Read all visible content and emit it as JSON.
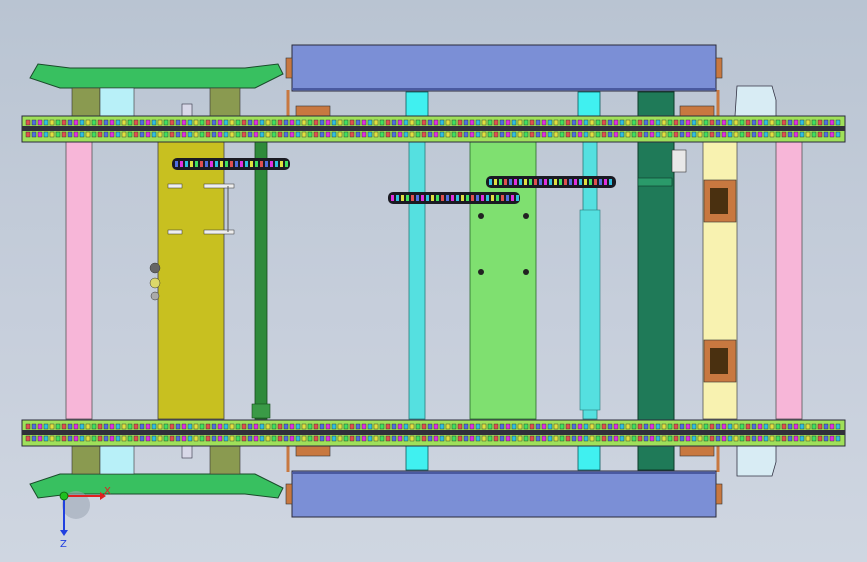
{
  "viewport": {
    "view": "top",
    "background_top": "#b9c4d2",
    "background_bottom": "#cfd6e1"
  },
  "triad": {
    "x_label": "X",
    "z_label": "Z",
    "x_color": "#e02020",
    "y_color": "#20c020",
    "z_color": "#2040e0"
  },
  "colors": {
    "pad": "#7b8fd6",
    "rail": "#9fe05a",
    "chain_link": "#30303a",
    "roller": "#f7b6d8",
    "olive_plate": "#c8c020",
    "green_plate": "#7fe070",
    "dark_green": "#1f7a58",
    "cream_plate": "#f8f2b0",
    "cyan_shaft": "#55e0e0",
    "bracket_green": "#38c060",
    "lightblue_block": "#b8f0f8",
    "copper": "#c87840",
    "olive_block": "#8a9a50"
  }
}
